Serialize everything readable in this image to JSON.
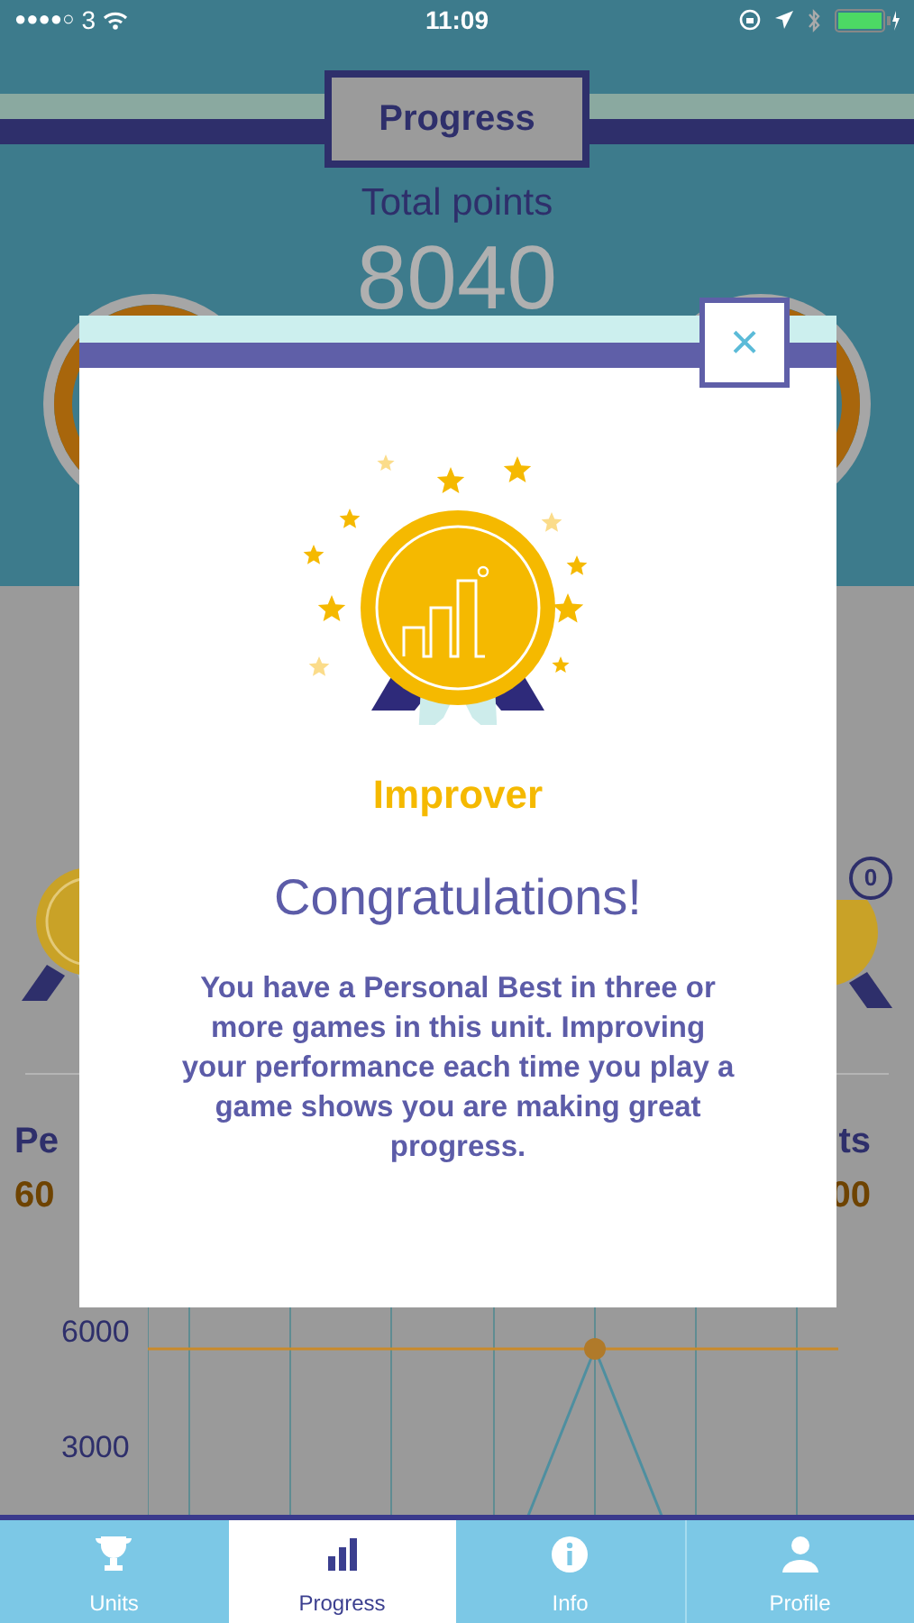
{
  "status_bar": {
    "signal": "●●●●○",
    "carrier": "3",
    "time": "11:09"
  },
  "header": {
    "title": "Progress",
    "subtitle": "Total points",
    "total": "8040"
  },
  "background": {
    "left_label": "Pe",
    "left_value": "60",
    "right_label": "ts",
    "right_value": "00",
    "badge": "0",
    "y_ticks": [
      "6000",
      "3000"
    ]
  },
  "modal": {
    "badge_name": "Improver",
    "heading": "Congratulations!",
    "message": "You have a Personal Best in three or more games in this unit. Improving your performance each time you play a game shows you are making great progress.",
    "close": "×"
  },
  "tabs": [
    {
      "label": "Units",
      "selected": false
    },
    {
      "label": "Progress",
      "selected": true
    },
    {
      "label": "Info",
      "selected": false
    },
    {
      "label": "Profile",
      "selected": false
    }
  ]
}
